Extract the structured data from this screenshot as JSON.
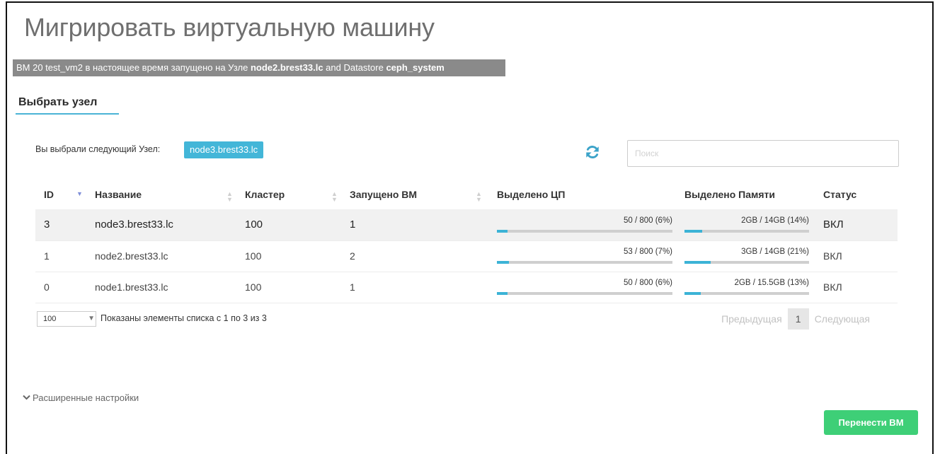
{
  "dialog": {
    "title": "Мигрировать виртуальную машину",
    "info": {
      "prefix": "ВМ 20 test_vm2 в настоящее время запущено на Узле ",
      "host": "node2.brest33.lc",
      "middle": " and Datastore ",
      "datastore": "ceph_system"
    },
    "section_tab": "Выбрать узел"
  },
  "selection": {
    "label": "Вы выбрали следующий Узел:",
    "value": "node3.brest33.lc"
  },
  "search": {
    "placeholder": "Поиск",
    "value": ""
  },
  "table": {
    "columns": [
      "ID",
      "Название",
      "Кластер",
      "Запущено ВМ",
      "Выделено ЦП",
      "Выделено Памяти",
      "Статус"
    ],
    "rows": [
      {
        "id": "3",
        "name": "node3.brest33.lc",
        "cluster": "100",
        "vms": "1",
        "cpu": "50 / 800 (6%)",
        "cpu_pct": 6,
        "mem": "2GB / 14GB (14%)",
        "mem_pct": 14,
        "status": "ВКЛ"
      },
      {
        "id": "1",
        "name": "node2.brest33.lc",
        "cluster": "100",
        "vms": "2",
        "cpu": "53 / 800 (7%)",
        "cpu_pct": 7,
        "mem": "3GB / 14GB (21%)",
        "mem_pct": 21,
        "status": "ВКЛ"
      },
      {
        "id": "0",
        "name": "node1.brest33.lc",
        "cluster": "100",
        "vms": "1",
        "cpu": "50 / 800 (6%)",
        "cpu_pct": 6,
        "mem": "2GB / 15.5GB (13%)",
        "mem_pct": 13,
        "status": "ВКЛ"
      }
    ]
  },
  "footer": {
    "page_length": "100",
    "info": "Показаны элементы списка с 1 по 3 из 3",
    "prev": "Предыдущая",
    "page": "1",
    "next": "Следующая"
  },
  "advanced_label": "Расширенные настройки",
  "migrate_button": "Перенести ВМ",
  "colors": {
    "accent": "#43b6d8",
    "success": "#3ecf77",
    "banner": "#8a8a8a"
  },
  "icons": {
    "refresh": "refresh-icon",
    "sort": "sort-icon",
    "expand": "chevron-down-icon",
    "dropdown": "caret-down-icon"
  }
}
